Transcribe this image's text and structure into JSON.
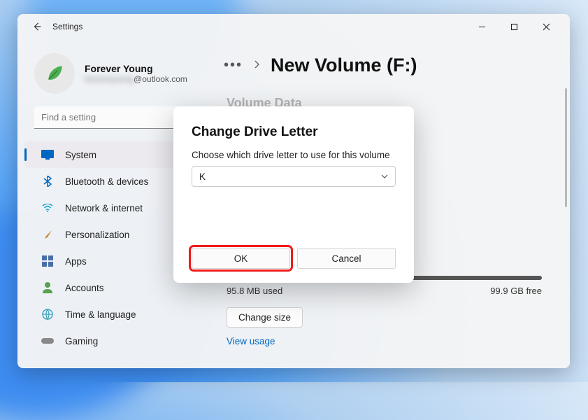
{
  "window": {
    "title": "Settings"
  },
  "profile": {
    "name": "Forever Young",
    "email_hidden": "foreveryoung",
    "email_suffix": "@outlook.com"
  },
  "search": {
    "placeholder": "Find a setting"
  },
  "sidebar": {
    "items": [
      {
        "label": "System"
      },
      {
        "label": "Bluetooth & devices"
      },
      {
        "label": "Network & internet"
      },
      {
        "label": "Personalization"
      },
      {
        "label": "Apps"
      },
      {
        "label": "Accounts"
      },
      {
        "label": "Time & language"
      },
      {
        "label": "Gaming"
      }
    ]
  },
  "breadcrumb": {
    "title": "New Volume (F:)"
  },
  "section": {
    "header": "Volume Data"
  },
  "usage": {
    "used": "95.8 MB used",
    "free": "99.9 GB free"
  },
  "buttons": {
    "change_size": "Change size",
    "view_usage": "View usage"
  },
  "modal": {
    "title": "Change Drive Letter",
    "prompt": "Choose which drive letter to use for this volume",
    "selected": "K",
    "ok": "OK",
    "cancel": "Cancel"
  }
}
